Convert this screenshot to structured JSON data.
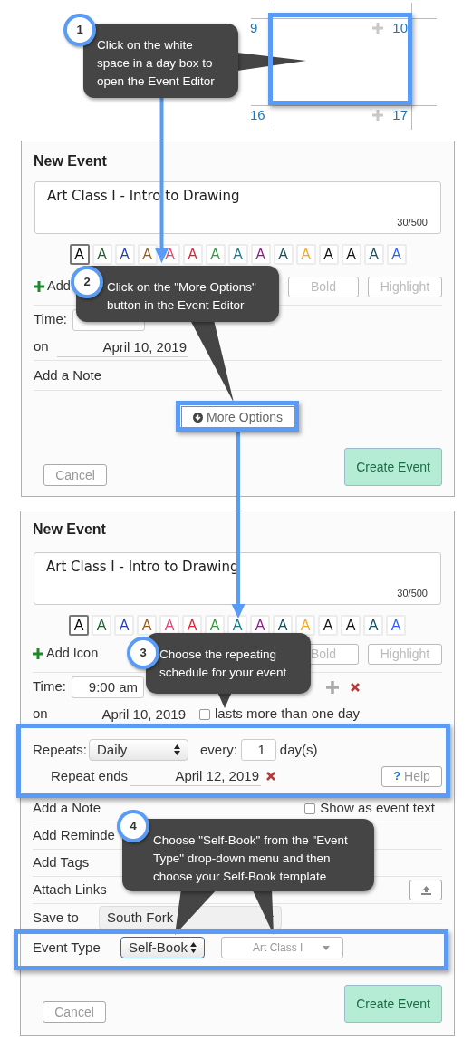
{
  "calendar": {
    "days": [
      {
        "number": "9",
        "add_button": false
      },
      {
        "number": "10",
        "add_button": true
      },
      {
        "number": "16",
        "add_button": false
      },
      {
        "number": "17",
        "add_button": true
      }
    ]
  },
  "steps": [
    {
      "number": "1",
      "text": "Click on the white space in a day box to open the Event Editor"
    },
    {
      "number": "2",
      "text": "Click on the \"More Options\" button in the Event Editor"
    },
    {
      "number": "3",
      "text": "Choose the repeating schedule for your event"
    },
    {
      "number": "4",
      "text": "Choose \"Self-Book\" from the \"Event Type\" drop-down menu and then choose your Self-Book template"
    }
  ],
  "editors": [
    {
      "title": "New Event",
      "name_value": "Art Class I - Intro to Drawing",
      "counter": "30/500",
      "swatches": [
        {
          "label": "A",
          "color": "#000000",
          "selected": true
        },
        {
          "label": "A",
          "color": "#1e5e2a",
          "selected": false
        },
        {
          "label": "A",
          "color": "#1f3fb0",
          "selected": false
        },
        {
          "label": "A",
          "color": "#9b5a1a",
          "selected": false
        },
        {
          "label": "A",
          "color": "#e0457b",
          "selected": false
        },
        {
          "label": "A",
          "color": "#e0202e",
          "selected": false
        },
        {
          "label": "A",
          "color": "#2e9a3a",
          "selected": false
        },
        {
          "label": "A",
          "color": "#127a8a",
          "selected": false
        },
        {
          "label": "A",
          "color": "#8a1a8a",
          "selected": false
        },
        {
          "label": "A",
          "color": "#124f5e",
          "selected": false
        },
        {
          "label": "A",
          "color": "#f5a623",
          "selected": false
        },
        {
          "label": "A",
          "color": "#111111",
          "selected": false
        },
        {
          "label": "A",
          "color": "#111111",
          "selected": false
        },
        {
          "label": "A",
          "color": "#124f5e",
          "selected": false
        },
        {
          "label": "A",
          "color": "#2f5cff",
          "selected": false
        }
      ],
      "add_icon": "Add",
      "format_buttons": [
        "Bold",
        "Highlight"
      ],
      "time_label": "Time:",
      "on_label": "on",
      "date": "April 10, 2019",
      "rows": [
        {
          "kind": "plain",
          "label": "Add a Note"
        }
      ],
      "more_options": "More Options",
      "cancel": "Cancel",
      "create": "Create Event"
    },
    {
      "title": "New Event",
      "name_value": "Art Class I - Intro to Drawing",
      "counter": "30/500",
      "swatches": [
        {
          "label": "A",
          "color": "#000000",
          "selected": true
        },
        {
          "label": "A",
          "color": "#1e5e2a",
          "selected": false
        },
        {
          "label": "A",
          "color": "#1f3fb0",
          "selected": false
        },
        {
          "label": "A",
          "color": "#9b5a1a",
          "selected": false
        },
        {
          "label": "A",
          "color": "#e0457b",
          "selected": false
        },
        {
          "label": "A",
          "color": "#e0202e",
          "selected": false
        },
        {
          "label": "A",
          "color": "#2e9a3a",
          "selected": false
        },
        {
          "label": "A",
          "color": "#127a8a",
          "selected": false
        },
        {
          "label": "A",
          "color": "#8a1a8a",
          "selected": false
        },
        {
          "label": "A",
          "color": "#124f5e",
          "selected": false
        },
        {
          "label": "A",
          "color": "#f5a623",
          "selected": false
        },
        {
          "label": "A",
          "color": "#111111",
          "selected": false
        },
        {
          "label": "A",
          "color": "#111111",
          "selected": false
        },
        {
          "label": "A",
          "color": "#124f5e",
          "selected": false
        },
        {
          "label": "A",
          "color": "#2f5cff",
          "selected": false
        }
      ],
      "add_icon": "Add Icon",
      "format_buttons": [
        "Bold",
        "Highlight"
      ],
      "time_label": "Time:",
      "start_time": "9:00 am",
      "on_label": "on",
      "date": "April 10, 2019",
      "multi_day": {
        "label": "lasts more than one day",
        "checked": false
      },
      "repeat": {
        "label": "Repeats:",
        "value": "Daily",
        "every": "every:",
        "interval": "1",
        "unit": "day(s)",
        "ends_label": "Repeat ends",
        "ends_date": "April 12, 2019",
        "help_icon": "?",
        "help": "Help"
      },
      "rows": [
        {
          "kind": "checkbox",
          "label": "Add a Note",
          "option": "Show as event text",
          "checked": false
        },
        {
          "kind": "plain",
          "label": "Add Reminde"
        },
        {
          "kind": "plain",
          "label": "Add Tags"
        },
        {
          "kind": "upload",
          "label": "Attach Links"
        },
        {
          "kind": "select",
          "label": "Save to",
          "value": "South Fork"
        }
      ],
      "event_type": {
        "label": "Event Type",
        "value": "Self-Book",
        "template": "Art Class I"
      },
      "cancel": "Cancel",
      "create": "Create Event"
    }
  ]
}
